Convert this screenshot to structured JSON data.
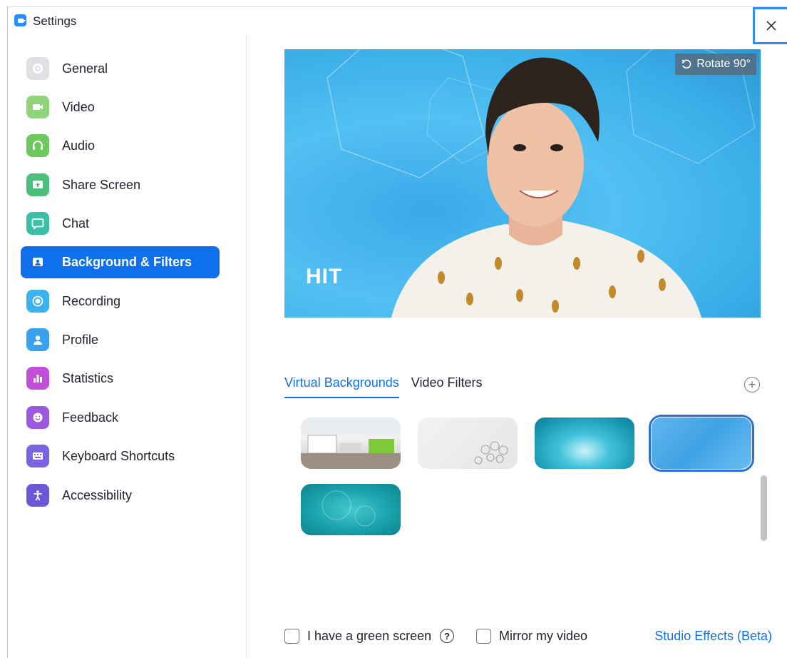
{
  "window": {
    "title": "Settings"
  },
  "sidebar": {
    "items": [
      {
        "label": "General",
        "icon": "gear-icon",
        "color": "#e0e0e4"
      },
      {
        "label": "Video",
        "icon": "video-camera-icon",
        "color": "#6fc75f"
      },
      {
        "label": "Audio",
        "icon": "headphones-icon",
        "color": "#6fc75f"
      },
      {
        "label": "Share Screen",
        "icon": "share-screen-icon",
        "color": "#4cbf7e"
      },
      {
        "label": "Chat",
        "icon": "chat-icon",
        "color": "#3cbfa7"
      },
      {
        "label": "Background & Filters",
        "icon": "background-icon",
        "color": "#0e71eb",
        "active": true
      },
      {
        "label": "Recording",
        "icon": "record-icon",
        "color": "#3cb3f0"
      },
      {
        "label": "Profile",
        "icon": "profile-icon",
        "color": "#3aa0f0"
      },
      {
        "label": "Statistics",
        "icon": "statistics-icon",
        "color": "#c14fd8"
      },
      {
        "label": "Feedback",
        "icon": "feedback-icon",
        "color": "#9b59e0"
      },
      {
        "label": "Keyboard Shortcuts",
        "icon": "keyboard-icon",
        "color": "#7a64e0"
      },
      {
        "label": "Accessibility",
        "icon": "accessibility-icon",
        "color": "#6b58d8"
      }
    ]
  },
  "preview": {
    "rotate_label": "Rotate 90°",
    "logo_text": "HIT"
  },
  "tabs": [
    {
      "label": "Virtual Backgrounds",
      "active": true
    },
    {
      "label": "Video Filters",
      "active": false
    }
  ],
  "thumbnails": [
    {
      "name": "office",
      "selected": false
    },
    {
      "name": "lightbulbs-white",
      "selected": false
    },
    {
      "name": "teal-glow",
      "selected": false
    },
    {
      "name": "blue-hexagon",
      "selected": true
    },
    {
      "name": "teal-bubbles",
      "selected": false
    }
  ],
  "options": {
    "green_screen_label": "I have a green screen",
    "mirror_label": "Mirror my video",
    "studio_effects_label": "Studio Effects (Beta)"
  }
}
